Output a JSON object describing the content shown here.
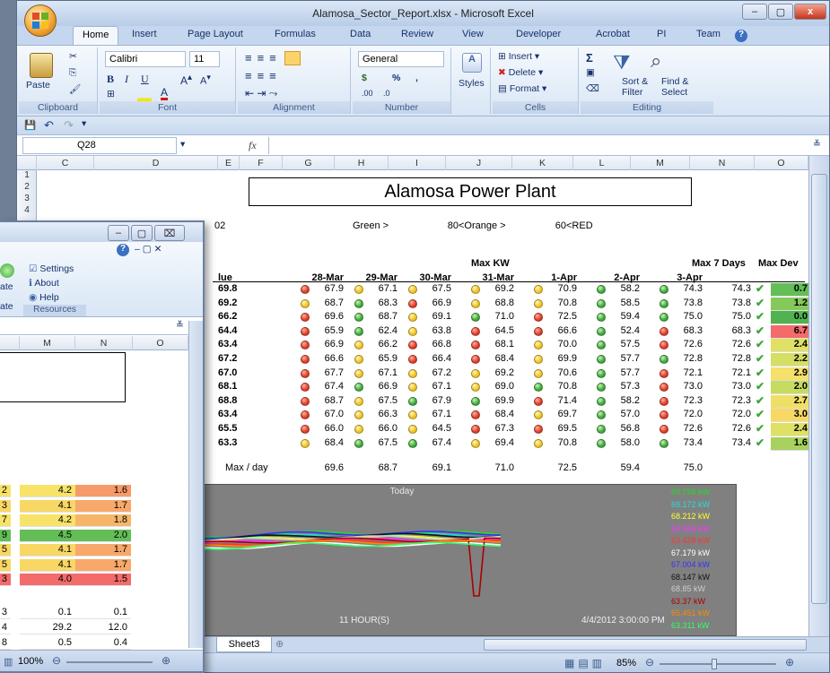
{
  "window": {
    "title": "Alamosa_Sector_Report.xlsx - Microsoft Excel",
    "min": "–",
    "max": "▢",
    "close": "x"
  },
  "tabs": [
    "Home",
    "Insert",
    "Page Layout",
    "Formulas",
    "Data",
    "Review",
    "View",
    "Developer",
    "Acrobat",
    "PI",
    "Team"
  ],
  "ribbon": {
    "clipboard": {
      "paste": "Paste",
      "label": "Clipboard"
    },
    "font": {
      "name": "Calibri",
      "size": "11",
      "label": "Font"
    },
    "alignment": {
      "label": "Alignment"
    },
    "number": {
      "format": "General",
      "currency": "$",
      "percent": "%",
      "comma": ",",
      "label": "Number",
      "dec_inc": ".00",
      "dec_dec": ".0"
    },
    "styles": {
      "label": "Styles"
    },
    "cells": {
      "insert": "Insert",
      "delete": "Delete",
      "format": "Format",
      "label": "Cells"
    },
    "editing": {
      "sort": "Sort &",
      "sort2": "Filter",
      "find": "Find &",
      "find2": "Select",
      "label": "Editing",
      "sigma": "Σ"
    }
  },
  "formula_bar": {
    "name_box": "Q28",
    "fx": "fx"
  },
  "columns": [
    "C",
    "D",
    "E",
    "F",
    "G",
    "H",
    "I",
    "J",
    "K",
    "L",
    "M",
    "N",
    "O"
  ],
  "rows": [
    "1",
    "2",
    "3",
    "4"
  ],
  "sheet": {
    "title": "Alamosa Power Plant",
    "e6": "02",
    "green_label": "Green >",
    "green_val": "80",
    "orange_label": "<Orange >",
    "orange_val": "60",
    "red_label": "<RED",
    "max_kw": "Max KW",
    "max7": "Max 7 Days",
    "maxdev": "Max Dev",
    "value_hdr": "lue",
    "dates": [
      "28-Mar",
      "29-Mar",
      "30-Mar",
      "31-Mar",
      "1-Apr",
      "2-Apr",
      "3-Apr"
    ],
    "rows": [
      {
        "v": "69.8",
        "d": [
          "67.9",
          "67.1",
          "67.5",
          "69.2",
          "70.9",
          "58.2",
          "74.3"
        ],
        "c": [
          "red",
          "yellow",
          "yellow",
          "yellow",
          "yellow",
          "green",
          "green"
        ],
        "m7": "74.3",
        "md": "0.7",
        "mdc": "#63be57"
      },
      {
        "v": "69.2",
        "d": [
          "68.7",
          "68.3",
          "66.9",
          "68.8",
          "70.8",
          "58.5",
          "73.8"
        ],
        "c": [
          "yellow",
          "green",
          "red",
          "yellow",
          "yellow",
          "green",
          "green"
        ],
        "m7": "73.8",
        "md": "1.2",
        "mdc": "#85c95a"
      },
      {
        "v": "66.2",
        "d": [
          "69.6",
          "68.7",
          "69.1",
          "71.0",
          "72.5",
          "59.4",
          "75.0"
        ],
        "c": [
          "red",
          "green",
          "yellow",
          "green",
          "red",
          "green",
          "green"
        ],
        "m7": "75.0",
        "md": "0.0",
        "mdc": "#4fb34f"
      },
      {
        "v": "64.4",
        "d": [
          "65.9",
          "62.4",
          "63.8",
          "64.5",
          "66.6",
          "52.4",
          "68.3"
        ],
        "c": [
          "red",
          "green",
          "yellow",
          "red",
          "red",
          "green",
          "red"
        ],
        "m7": "68.3",
        "md": "6.7",
        "mdc": "#f36b6b"
      },
      {
        "v": "63.4",
        "d": [
          "66.9",
          "66.2",
          "66.8",
          "68.1",
          "70.0",
          "57.5",
          "72.6"
        ],
        "c": [
          "red",
          "yellow",
          "red",
          "red",
          "yellow",
          "green",
          "red"
        ],
        "m7": "72.6",
        "md": "2.4",
        "mdc": "#e0e065"
      },
      {
        "v": "67.2",
        "d": [
          "66.6",
          "65.9",
          "66.4",
          "68.4",
          "69.9",
          "57.7",
          "72.8"
        ],
        "c": [
          "red",
          "yellow",
          "red",
          "red",
          "yellow",
          "green",
          "green"
        ],
        "m7": "72.8",
        "md": "2.2",
        "mdc": "#d4df63"
      },
      {
        "v": "67.0",
        "d": [
          "67.7",
          "67.1",
          "67.2",
          "69.2",
          "70.6",
          "57.7",
          "72.1"
        ],
        "c": [
          "red",
          "yellow",
          "yellow",
          "yellow",
          "yellow",
          "green",
          "red"
        ],
        "m7": "72.1",
        "md": "2.9",
        "mdc": "#f5e06a"
      },
      {
        "v": "68.1",
        "d": [
          "67.4",
          "66.9",
          "67.1",
          "69.0",
          "70.8",
          "57.3",
          "73.0"
        ],
        "c": [
          "red",
          "green",
          "yellow",
          "yellow",
          "green",
          "green",
          "red"
        ],
        "m7": "73.0",
        "md": "2.0",
        "mdc": "#c6db60"
      },
      {
        "v": "68.8",
        "d": [
          "68.7",
          "67.5",
          "67.9",
          "69.9",
          "71.4",
          "58.2",
          "72.3"
        ],
        "c": [
          "red",
          "yellow",
          "green",
          "green",
          "red",
          "green",
          "red"
        ],
        "m7": "72.3",
        "md": "2.7",
        "mdc": "#eee067"
      },
      {
        "v": "63.4",
        "d": [
          "67.0",
          "66.3",
          "67.1",
          "68.4",
          "69.7",
          "57.0",
          "72.0"
        ],
        "c": [
          "red",
          "yellow",
          "yellow",
          "red",
          "yellow",
          "green",
          "red"
        ],
        "m7": "72.0",
        "md": "3.0",
        "mdc": "#f8d865"
      },
      {
        "v": "65.5",
        "d": [
          "66.0",
          "66.0",
          "64.5",
          "67.3",
          "69.5",
          "56.8",
          "72.6"
        ],
        "c": [
          "red",
          "yellow",
          "yellow",
          "red",
          "red",
          "green",
          "red"
        ],
        "m7": "72.6",
        "md": "2.4",
        "mdc": "#e0e065"
      },
      {
        "v": "63.3",
        "d": [
          "68.4",
          "67.5",
          "67.4",
          "69.4",
          "70.8",
          "58.0",
          "73.4"
        ],
        "c": [
          "yellow",
          "green",
          "green",
          "yellow",
          "yellow",
          "green",
          "green"
        ],
        "m7": "73.4",
        "md": "1.6",
        "mdc": "#a8d25d"
      }
    ],
    "maxday_label": "Max / day",
    "maxday": [
      "69.6",
      "68.7",
      "69.1",
      "71.0",
      "72.5",
      "59.4",
      "75.0"
    ]
  },
  "chart": {
    "title": "Today",
    "xlabel": "11 HOUR(S)",
    "timestamp": "4/4/2012 3:00:00 PM",
    "legend": [
      {
        "t": "69.758 kW",
        "c": "#22dd22"
      },
      {
        "t": "69.172 kW",
        "c": "#22dddd"
      },
      {
        "t": "68.212 kW",
        "c": "#ffff33"
      },
      {
        "t": "64.366 kW",
        "c": "#ff33ff"
      },
      {
        "t": "63.428 kW",
        "c": "#ff3333"
      },
      {
        "t": "67.179 kW",
        "c": "#ffffff"
      },
      {
        "t": "67.004 kW",
        "c": "#3333ff"
      },
      {
        "t": "68.147 kW",
        "c": "#111111"
      },
      {
        "t": "68.85 kW",
        "c": "#cccccc"
      },
      {
        "t": "63.37 kW",
        "c": "#aa0000"
      },
      {
        "t": "65.451 kW",
        "c": "#ff8800"
      },
      {
        "t": "63.311 kW",
        "c": "#33ff66"
      }
    ]
  },
  "sheettab": "Sheet3",
  "status": {
    "zoom": "85%"
  },
  "win2": {
    "settings": "Settings",
    "about": "About",
    "help": "Help",
    "resources": "Resources",
    "partial_a": "ate",
    "partial_b": "ate",
    "cols": [
      "M",
      "N",
      "O"
    ],
    "cells": [
      {
        "a": "2",
        "m": "4.2",
        "n": "1.6",
        "mc": "#f8e36a",
        "nc": "#f79a6a"
      },
      {
        "a": "3",
        "m": "4.1",
        "n": "1.7",
        "mc": "#f8d765",
        "nc": "#f8a86a"
      },
      {
        "a": "7",
        "m": "4.2",
        "n": "1.8",
        "mc": "#f8e36a",
        "nc": "#f6b66a"
      },
      {
        "a": "9",
        "m": "4.5",
        "n": "2.0",
        "mc": "#63be57",
        "nc": "#63be57"
      },
      {
        "a": "5",
        "m": "4.1",
        "n": "1.7",
        "mc": "#f8d765",
        "nc": "#f8a86a"
      },
      {
        "a": "5",
        "m": "4.1",
        "n": "1.7",
        "mc": "#f8d765",
        "nc": "#f8a86a"
      },
      {
        "a": "3",
        "m": "4.0",
        "n": "1.5",
        "mc": "#f36b6b",
        "nc": "#f36b6b"
      }
    ],
    "bottom": [
      {
        "a": "3",
        "m": "0.1",
        "n": "0.1"
      },
      {
        "a": "4",
        "m": "29.2",
        "n": "12.0"
      },
      {
        "a": "8",
        "m": "0.5",
        "n": "0.4"
      }
    ],
    "zoom": "100%"
  }
}
